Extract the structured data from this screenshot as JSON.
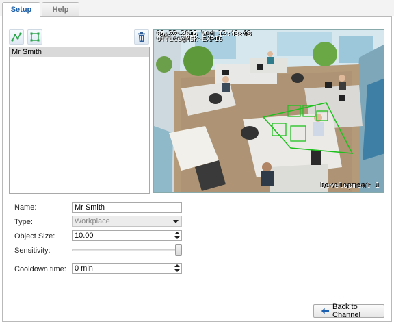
{
  "tabs": [
    {
      "label": "Setup",
      "active": true
    },
    {
      "label": "Help",
      "active": false
    }
  ],
  "toolbar": {
    "polygon_tool_icon": "polygon-draw-icon",
    "rectangle_tool_icon": "rectangle-draw-icon",
    "delete_icon": "trash-icon"
  },
  "zones": [
    {
      "name": "Mr Smith",
      "selected": true
    }
  ],
  "video": {
    "osd_datetime": "05-22-2015 Wed 12:43:48",
    "osd_camera": "Office@MSK-EXP16",
    "osd_caption": "Development 1",
    "zone_color": "#1fc11f"
  },
  "form": {
    "name": {
      "label": "Name:",
      "value": "Mr Smith"
    },
    "type": {
      "label": "Type:",
      "value": "Workplace"
    },
    "object_size": {
      "label": "Object Size:",
      "value": "10.00"
    },
    "sensitivity": {
      "label": "Sensitivity:",
      "level": 1.0
    },
    "cooldown": {
      "label": "Cooldown time:",
      "value": "0 min"
    }
  },
  "back_button": {
    "label": "Back to Channel",
    "icon": "arrow-left-icon",
    "accent": "#1b5fb0"
  }
}
